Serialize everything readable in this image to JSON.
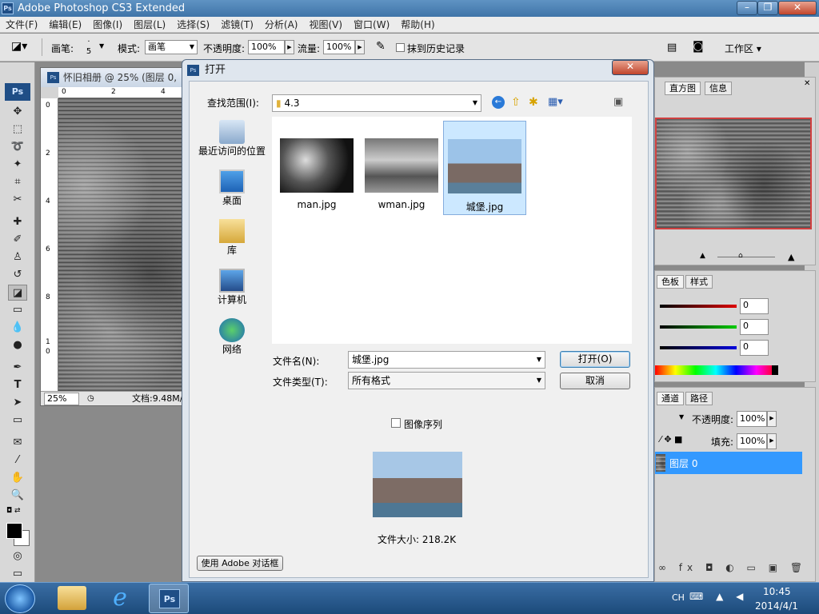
{
  "app": {
    "title": "Adobe Photoshop CS3 Extended",
    "icon": "Ps"
  },
  "menu": [
    "文件(F)",
    "编辑(E)",
    "图像(I)",
    "图层(L)",
    "选择(S)",
    "滤镜(T)",
    "分析(A)",
    "视图(V)",
    "窗口(W)",
    "帮助(H)"
  ],
  "options": {
    "brush_label": "画笔:",
    "brush_size": "5",
    "mode_label": "模式:",
    "mode_value": "画笔",
    "opacity_label": "不透明度:",
    "opacity_value": "100%",
    "flow_label": "流量:",
    "flow_value": "100%",
    "history_label": "抹到历史记录",
    "workspace": "工作区"
  },
  "document": {
    "title": "怀旧相册 @ 25% (图层 0,",
    "zoom": "25%",
    "doc_info": "文档:9.48M/",
    "ruler_top": [
      "0",
      "2",
      "4"
    ],
    "ruler_left": [
      "0",
      "2",
      "4",
      "6",
      "8",
      "1",
      "0"
    ]
  },
  "panels": {
    "nav_tabs": [
      "直方图",
      "信息"
    ],
    "color_tabs": [
      "色板",
      "样式"
    ],
    "color_values": [
      "0",
      "0",
      "0"
    ],
    "layer_tabs": [
      "通道",
      "路径"
    ],
    "opacity_label": "不透明度:",
    "opacity_value": "100%",
    "fill_label": "填充:",
    "fill_value": "100%",
    "layer_name": "图层 0"
  },
  "dialog": {
    "title": "打开",
    "look_in_label": "查找范围(I):",
    "look_in_value": "4.3",
    "places": [
      "最近访问的位置",
      "桌面",
      "库",
      "计算机",
      "网络"
    ],
    "files": [
      {
        "name": "man.jpg",
        "selected": false
      },
      {
        "name": "wman.jpg",
        "selected": false
      },
      {
        "name": "城堡.jpg",
        "selected": true
      }
    ],
    "filename_label": "文件名(N):",
    "filename_value": "城堡.jpg",
    "filetype_label": "文件类型(T):",
    "filetype_value": "所有格式",
    "open_button": "打开(O)",
    "cancel_button": "取消",
    "sequence_label": "图像序列",
    "filesize": "文件大小: 218.2K",
    "adobe_dialog_button": "使用 Adobe 对话框"
  },
  "taskbar": {
    "lang": "CH",
    "time": "10:45",
    "date": "2014/4/1"
  },
  "colors": {
    "selection": "#cce8ff",
    "layer_selected": "#3399ff"
  }
}
